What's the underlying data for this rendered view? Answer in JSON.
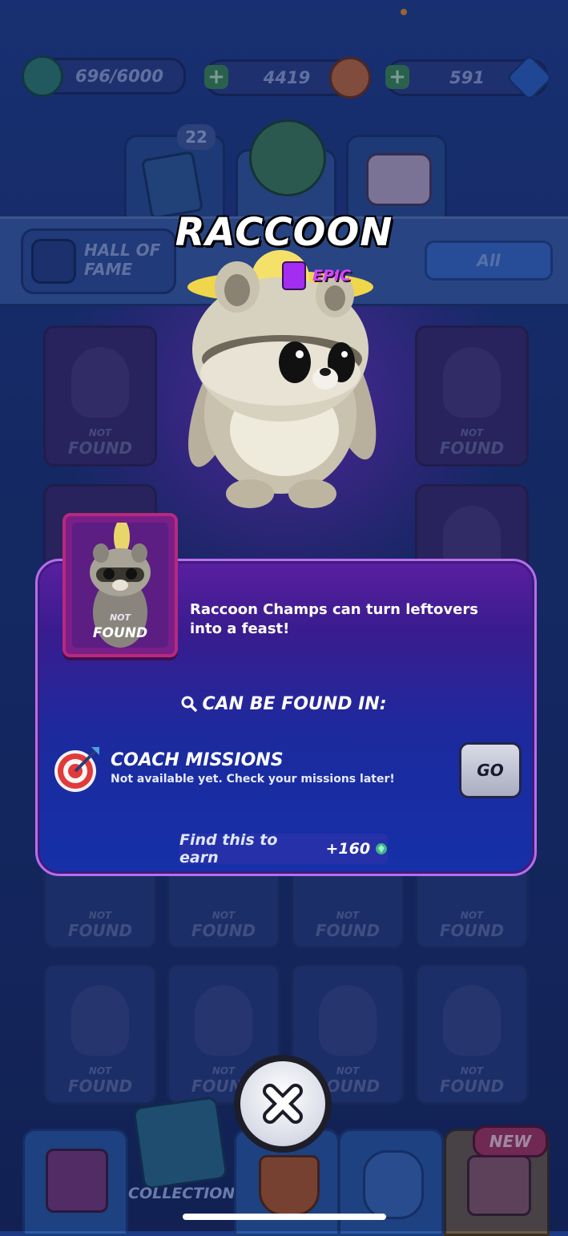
{
  "currencies": [
    {
      "name": "trophy-progress",
      "value": "696/6000"
    },
    {
      "name": "coins",
      "value": "4419"
    },
    {
      "name": "gems",
      "value": "591"
    }
  ],
  "tabs": {
    "cards_badge": "22"
  },
  "header": {
    "hall_of_fame_label": "HALL OF FAME",
    "filter_label": "All"
  },
  "background_cards": {
    "not_label": "NOT",
    "found_label": "FOUND"
  },
  "character": {
    "name": "RACCOON",
    "rarity": "EPIC",
    "card_not": "NOT",
    "card_found": "FOUND",
    "description": "Raccoon Champs can turn leftovers into a feast!"
  },
  "source": {
    "heading": "CAN BE FOUND IN:",
    "mission_title": "COACH MISSIONS",
    "mission_subtitle": "Not available yet. Check your missions later!",
    "go_label": "GO"
  },
  "reward": {
    "prefix": "Find this to earn",
    "amount": "+160"
  },
  "bottom_nav": {
    "collection_label": "COLLECTION",
    "new_badge": "NEW"
  },
  "colors": {
    "epic": "#d645ff",
    "modal_border": "#b86cf0"
  }
}
